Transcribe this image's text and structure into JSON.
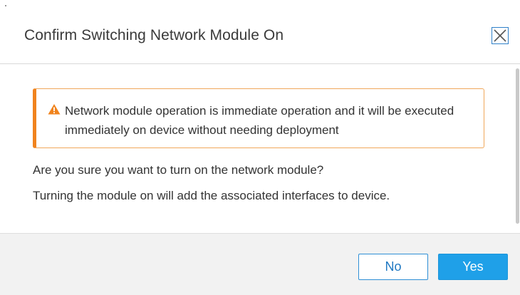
{
  "dialog": {
    "title": "Confirm Switching Network Module On",
    "close_icon": "close-icon"
  },
  "alert": {
    "icon": "warning-icon",
    "accent_color": "#f0831d",
    "message": "Network module operation is immediate operation and it will be executed immediately on device without needing deployment"
  },
  "body": {
    "question": "Are you sure you want to turn on the network module?",
    "note": "Turning the module on will add the associated interfaces to device."
  },
  "buttons": {
    "no_label": "No",
    "yes_label": "Yes",
    "primary_color": "#1fa0e8"
  }
}
